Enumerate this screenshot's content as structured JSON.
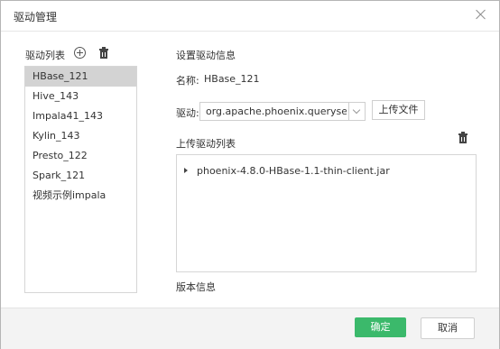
{
  "dialog": {
    "title": "驱动管理"
  },
  "driver_list": {
    "label": "驱动列表",
    "items": [
      {
        "label": "HBase_121",
        "selected": true
      },
      {
        "label": "Hive_143"
      },
      {
        "label": "Impala41_143"
      },
      {
        "label": "Kylin_143"
      },
      {
        "label": "Presto_122"
      },
      {
        "label": "Spark_121"
      },
      {
        "label": "视频示例impala"
      }
    ]
  },
  "settings": {
    "heading": "设置驱动信息",
    "name_label": "名称:",
    "name_value": "HBase_121",
    "driver_label": "驱动:",
    "driver_value": "org.apache.phoenix.queryserver.client.Driver",
    "upload_button": "上传文件",
    "upload_list_label": "上传驱动列表",
    "files": [
      {
        "name": "phoenix-4.8.0-HBase-1.1-thin-client.jar"
      }
    ],
    "version_label": "版本信息"
  },
  "footer": {
    "ok_label": "确定",
    "cancel_label": "取消"
  }
}
